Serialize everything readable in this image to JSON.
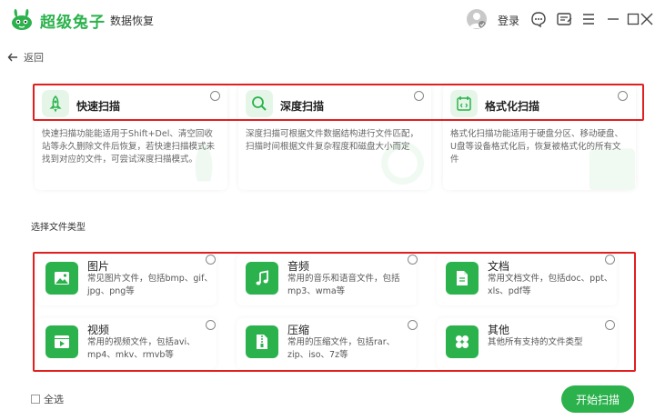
{
  "app": {
    "brand": "超级兔子",
    "subtitle": "数据恢复",
    "login_label": "登录"
  },
  "nav": {
    "back_label": "返回"
  },
  "scan_modes": [
    {
      "title": "快速扫描",
      "icon": "rocket-icon",
      "description": "快速扫描功能能适用于Shift+Del、清空回收站等永久删除文件后恢复，若快速扫描模式未找到对应的文件，可尝试深度扫描模式。"
    },
    {
      "title": "深度扫描",
      "icon": "magnifier-icon",
      "description": "深度扫描可根据文件数据结构进行文件匹配，扫描时间根据文件复杂程度和磁盘大小而定"
    },
    {
      "title": "格式化扫描",
      "icon": "code-calendar-icon",
      "description": "格式化扫描功能适用于硬盘分区、移动硬盘、U盘等设备格式化后，恢复被格式化的所有文件"
    }
  ],
  "file_types": {
    "section_label": "选择文件类型",
    "items": [
      {
        "title": "图片",
        "icon": "image-icon",
        "description": "常见图片文件，包括bmp、gif、jpg、png等"
      },
      {
        "title": "音频",
        "icon": "music-note-icon",
        "description": "常用的音乐和语音文件，包括mp3、wma等"
      },
      {
        "title": "文档",
        "icon": "document-icon",
        "description": "常用文档文件，包括doc、ppt、xls、pdf等"
      },
      {
        "title": "视频",
        "icon": "video-icon",
        "description": "常用的视频文件，包括avi、mp4、mkv、rmvb等"
      },
      {
        "title": "压缩",
        "icon": "zip-icon",
        "description": "常用的压缩文件，包括rar、zip、iso、7z等"
      },
      {
        "title": "其他",
        "icon": "four-leaf-icon",
        "description": "其他所有支持的文件类型"
      }
    ]
  },
  "footer": {
    "select_all_label": "全选",
    "start_label": "开始扫描"
  },
  "colors": {
    "accent": "#2bb24c",
    "highlight_frame": "#e02020"
  }
}
